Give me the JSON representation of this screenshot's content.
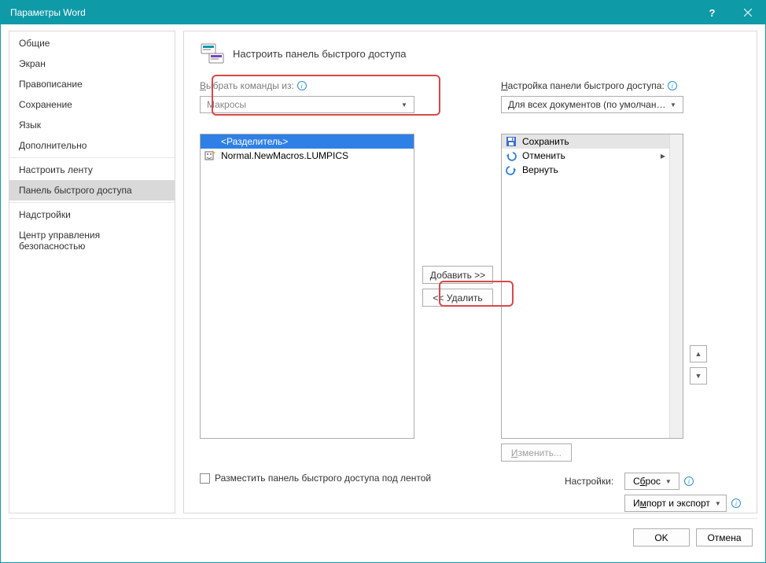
{
  "titlebar": {
    "title": "Параметры Word"
  },
  "nav": {
    "groups": [
      [
        "Общие",
        "Экран",
        "Правописание",
        "Сохранение",
        "Язык",
        "Дополнительно"
      ],
      [
        "Настроить ленту",
        "Панель быстрого доступа"
      ],
      [
        "Надстройки",
        "Центр управления безопасностью"
      ]
    ],
    "selected": "Панель быстрого доступа"
  },
  "section_title": "Настроить панель быстрого доступа",
  "left": {
    "label": "Выбрать команды из:",
    "dropdown": "Макросы",
    "items": [
      {
        "text": "<Разделитель>",
        "selected": true,
        "icon": ""
      },
      {
        "text": "Normal.NewMacros.LUMPICS",
        "selected": false,
        "icon": "macro"
      }
    ]
  },
  "rightcol": {
    "label": "Настройка панели быстрого доступа:",
    "dropdown": "Для всех документов (по умолчани...",
    "items": [
      {
        "text": "Сохранить",
        "icon": "save",
        "selected": true
      },
      {
        "text": "Отменить",
        "icon": "undo",
        "expandable": true
      },
      {
        "text": "Вернуть",
        "icon": "redo"
      }
    ]
  },
  "mid": {
    "add": "Добавить >>",
    "remove": "<< Удалить"
  },
  "modify": "Изменить...",
  "checkbox": "Разместить панель быстрого доступа под лентой",
  "settings": {
    "label": "Настройки:",
    "reset": "Сброс",
    "import": "Импорт и экспорт"
  },
  "footer": {
    "ok": "OK",
    "cancel": "Отмена"
  }
}
